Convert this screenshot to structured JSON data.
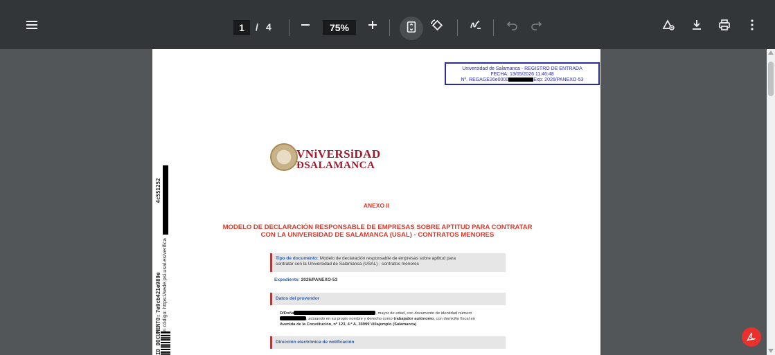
{
  "toolbar": {
    "page_current": "1",
    "page_separator": "/",
    "page_total": "4",
    "zoom_value": "75%"
  },
  "document": {
    "stamp": {
      "line1": "Universidad de Salamanca - REGISTRO DE ENTRADA",
      "line2": "FECHA: 13/05/2026 11:46:48",
      "line3_prefix": "Nº. REGAGE26e0000",
      "line3_suffix": "Exp: 2026/PANEXO-53"
    },
    "side": {
      "id_label": "ID DOCUMENTO:",
      "id_prefix": "7e9cb421e989e",
      "id_suffix": "4c551252",
      "verification": "Verificación código: https://sede.psi.usal.es/verifica"
    },
    "logo": {
      "line1": "VNiVERSiDAD",
      "line2": "ÐSALAMANCA"
    },
    "anexo": "ANEXO II",
    "title_line1": "MODELO DE DECLARACIÓN RESPONSABLE DE EMPRESAS SOBRE APTITUD PARA CONTRATAR",
    "title_line2": "CON LA UNIVERSIDAD DE SALAMANCA (USAL) - CONTRATOS MENORES",
    "tipo_label": "Tipo de documento:",
    "tipo_value1": "Modelo de declaración responsable de empresas sobre aptitud para",
    "tipo_value2": "contratar con la Universidad de Salamanca (USAL) - contratos menores",
    "expediente_label": "Expediente:",
    "expediente_value": "2026/PANEXO-53",
    "datos_header": "Datos del provendor",
    "body_l1_prefix": "D/Doña",
    "body_l1_suffix": ", mayor de edad, con documento de identidad número",
    "body_l2_suffix": ", actuando en su propio nombre y derecho como",
    "body_l2_bold": "trabajador autónomo",
    "body_l2_end": ", con domicilio fiscal en",
    "body_l3": "Avenida de la Constitución, nº 123, 4.º A, 39999 Villajemplo (Salamanca)",
    "direccion_header": "Dirección electrónica de notificación"
  },
  "colors": {
    "toolbar_bg": "#323639",
    "viewer_bg": "#525659",
    "title_red": "#d83a2a",
    "label_blue": "#2f5ea8",
    "adobe_red": "#e9302c"
  }
}
